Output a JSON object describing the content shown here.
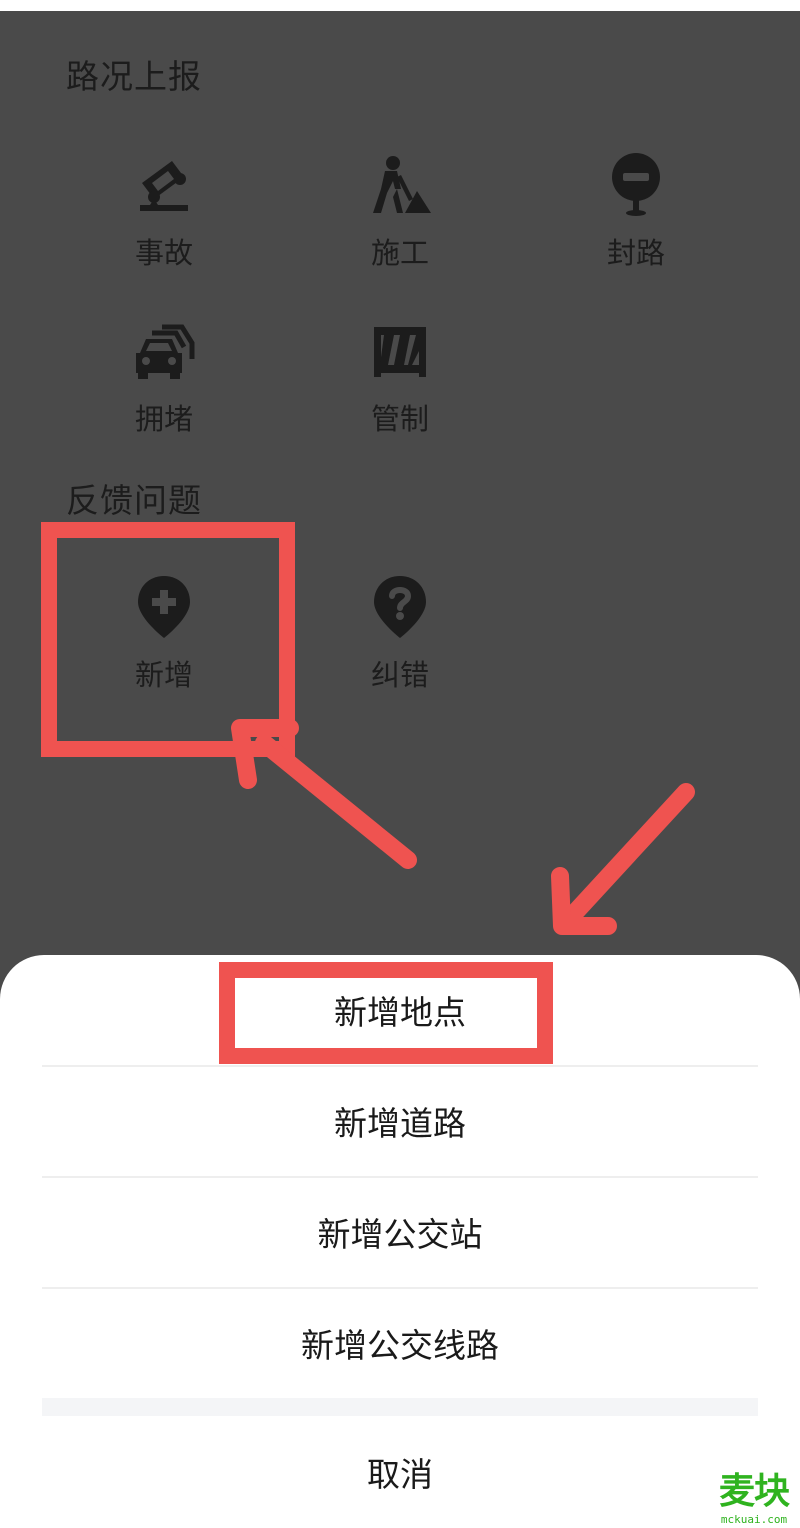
{
  "road_report": {
    "title": "路况上报",
    "items": [
      {
        "label": "事故",
        "icon": "accident-car-icon"
      },
      {
        "label": "施工",
        "icon": "construction-worker-icon"
      },
      {
        "label": "封路",
        "icon": "road-closed-icon"
      },
      {
        "label": "拥堵",
        "icon": "traffic-jam-icon"
      },
      {
        "label": "管制",
        "icon": "barrier-icon"
      }
    ]
  },
  "feedback": {
    "title": "反馈问题",
    "items": [
      {
        "label": "新增",
        "icon": "add-location-icon"
      },
      {
        "label": "纠错",
        "icon": "question-location-icon"
      }
    ]
  },
  "action_sheet": {
    "options": [
      "新增地点",
      "新增道路",
      "新增公交站",
      "新增公交线路"
    ],
    "cancel": "取消"
  },
  "watermark": {
    "logo": "麦块",
    "site": "mckuai.com"
  },
  "colors": {
    "overlay": "#4a4a4a",
    "highlight": "#ef5350",
    "icon": "#1c1c1c",
    "watermark": "#2fb31f"
  }
}
